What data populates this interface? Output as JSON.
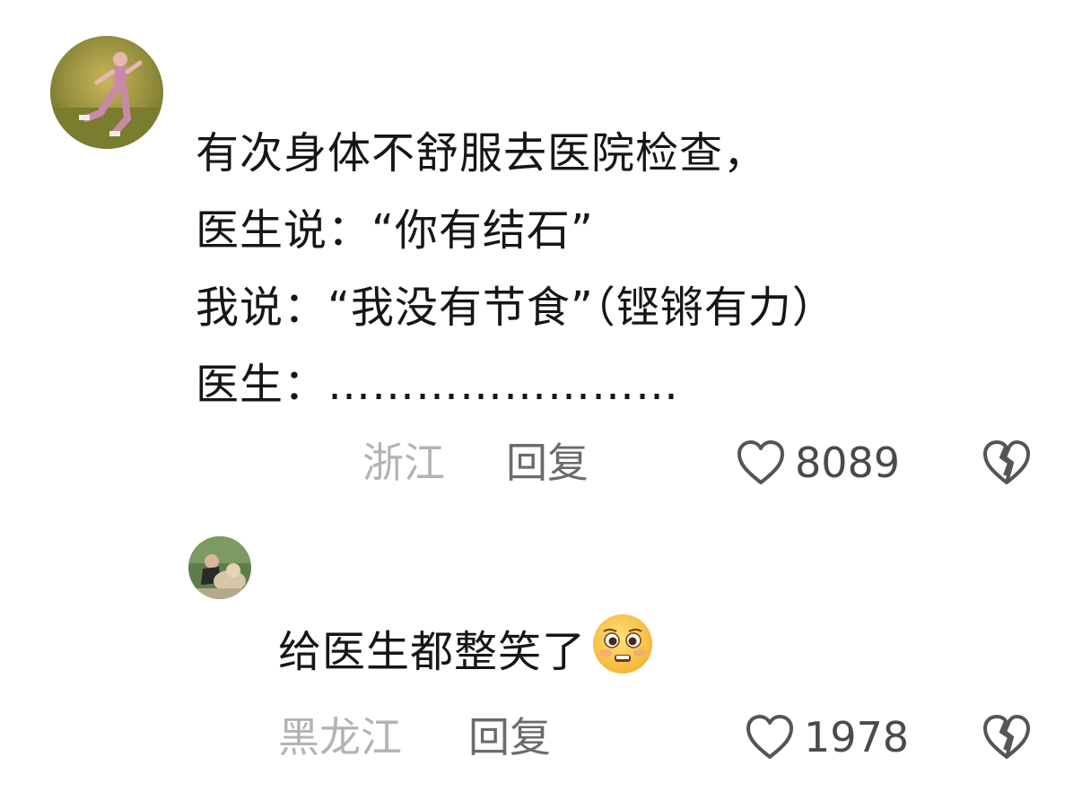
{
  "comment": {
    "lines": [
      "有次身体不舒服去医院检查，",
      "医生说：“你有结石”",
      "我说：“我没有节食”（铿锵有力）",
      "医生：……………………"
    ],
    "location": "浙江",
    "reply_label": "回复",
    "likes": "8089"
  },
  "reply": {
    "text": "给医生都整笑了",
    "emoji": "pleading-face-emoji",
    "location": "黑龙江",
    "reply_label": "回复",
    "likes": "1978"
  },
  "icons": {
    "like": "heart-outline-icon",
    "dislike": "broken-heart-icon"
  },
  "colors": {
    "text": "#161616",
    "location": "#b3b3b3",
    "reply_label": "#6b6b6b",
    "count": "#4a4a4a",
    "icon": "#555555"
  }
}
